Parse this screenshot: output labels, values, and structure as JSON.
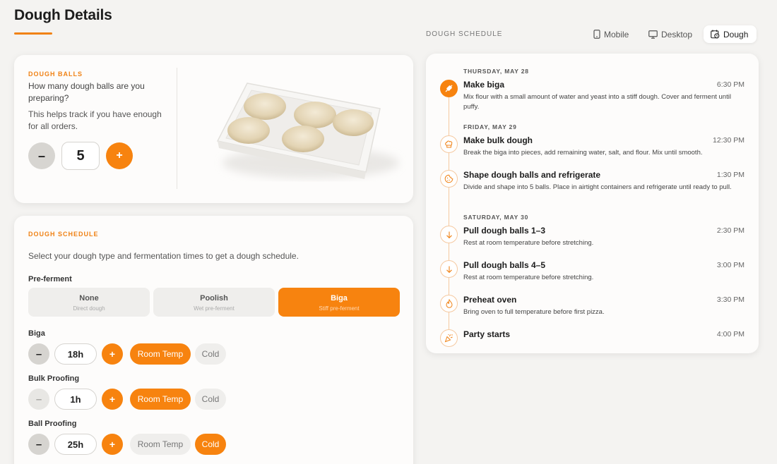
{
  "page": {
    "title": "Dough Details"
  },
  "colors": {
    "accent": "#f7830f",
    "background": "#f4f3f1",
    "card": "#fdfcfb"
  },
  "dough_balls": {
    "eyebrow": "DOUGH BALLS",
    "question": "How many dough balls are you preparing?",
    "hint": "This helps track if you have enough for all orders.",
    "count": "5",
    "minus_label": "–",
    "plus_label": "+"
  },
  "settings": {
    "eyebrow": "DOUGH SCHEDULE",
    "intro": "Select your dough type and fermentation times to get a dough schedule.",
    "preferment_label": "Pre-ferment",
    "preferment_options": [
      {
        "name": "None",
        "sub": "Direct dough",
        "selected": false
      },
      {
        "name": "Poolish",
        "sub": "Wet pre-ferment",
        "selected": false
      },
      {
        "name": "Biga",
        "sub": "Stiff pre-ferment",
        "selected": true
      }
    ],
    "rows": [
      {
        "label": "Biga",
        "value": "18h",
        "minus_disabled": false,
        "room_temp": "Room Temp",
        "cold": "Cold",
        "selected": "room"
      },
      {
        "label": "Bulk Proofing",
        "value": "1h",
        "minus_disabled": true,
        "room_temp": "Room Temp",
        "cold": "Cold",
        "selected": "room"
      },
      {
        "label": "Ball Proofing",
        "value": "25h",
        "minus_disabled": false,
        "room_temp": "Room Temp",
        "cold": "Cold",
        "selected": "cold"
      }
    ],
    "minus_label": "–",
    "plus_label": "+"
  },
  "schedule_header": {
    "label": "DOUGH SCHEDULE",
    "tabs": [
      {
        "label": "Mobile",
        "icon": "phone-icon",
        "active": false
      },
      {
        "label": "Desktop",
        "icon": "monitor-icon",
        "active": false
      },
      {
        "label": "Dough",
        "icon": "calendar-clock-icon",
        "active": true
      }
    ]
  },
  "timeline": {
    "days": [
      {
        "label": "THURSDAY, MAY 28"
      },
      {
        "label": "FRIDAY, MAY 29"
      },
      {
        "label": "SATURDAY, MAY 30"
      }
    ],
    "steps": [
      {
        "title": "Make biga",
        "time": "6:30 PM",
        "desc": "Mix flour with a small amount of water and yeast into a stiff dough. Cover and ferment until puffy.",
        "icon": "wheat-icon"
      },
      {
        "title": "Make bulk dough",
        "time": "12:30 PM",
        "desc": "Break the biga into pieces, add remaining water, salt, and flour. Mix until smooth.",
        "icon": "chef-hat-icon"
      },
      {
        "title": "Shape dough balls and refrigerate",
        "time": "1:30 PM",
        "desc": "Divide and shape into 5 balls. Place in airtight containers and refrigerate until ready to pull.",
        "icon": "cookie-icon"
      },
      {
        "title": "Pull dough balls 1–3",
        "time": "2:30 PM",
        "desc": "Rest at room temperature before stretching.",
        "icon": "arrow-down-icon"
      },
      {
        "title": "Pull dough balls 4–5",
        "time": "3:00 PM",
        "desc": "Rest at room temperature before stretching.",
        "icon": "arrow-down-icon"
      },
      {
        "title": "Preheat oven",
        "time": "3:30 PM",
        "desc": "Bring oven to full temperature before first pizza.",
        "icon": "flame-icon"
      },
      {
        "title": "Party starts",
        "time": "4:00 PM",
        "desc": "",
        "icon": "party-popper-icon"
      }
    ]
  }
}
